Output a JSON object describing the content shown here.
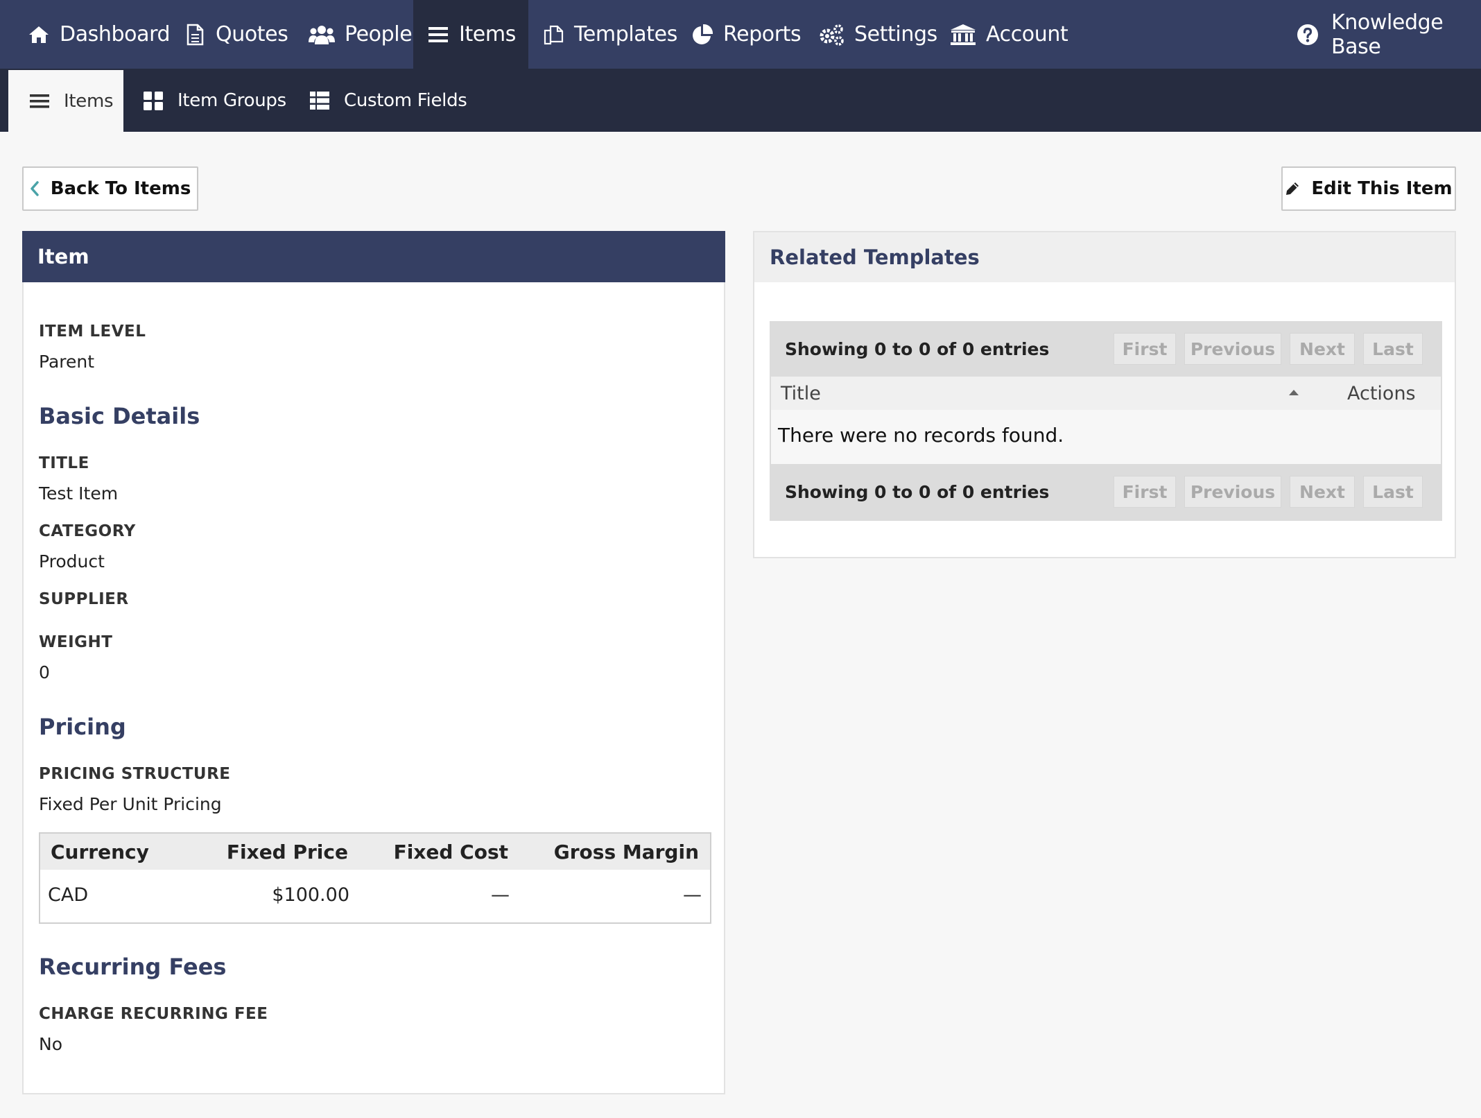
{
  "nav": {
    "items": [
      {
        "label": "Dashboard",
        "icon": "home-icon"
      },
      {
        "label": "Quotes",
        "icon": "document-icon"
      },
      {
        "label": "People",
        "icon": "people-icon"
      },
      {
        "label": "Items",
        "icon": "list-icon",
        "active": true
      },
      {
        "label": "Templates",
        "icon": "templates-icon"
      },
      {
        "label": "Reports",
        "icon": "pie-chart-icon"
      },
      {
        "label": "Settings",
        "icon": "gears-icon"
      },
      {
        "label": "Account",
        "icon": "bank-icon"
      }
    ],
    "help": {
      "label": "Knowledge Base",
      "icon": "question-circle-icon"
    }
  },
  "subnav": {
    "items": [
      {
        "label": "Items",
        "icon": "list-icon",
        "active": true
      },
      {
        "label": "Item Groups",
        "icon": "grid-icon"
      },
      {
        "label": "Custom Fields",
        "icon": "table-list-icon"
      }
    ]
  },
  "actions": {
    "back_label": "Back To Items",
    "edit_label": "Edit This Item"
  },
  "item_panel": {
    "title": "Item",
    "item_level_label": "ITEM LEVEL",
    "item_level_value": "Parent",
    "basic_details_heading": "Basic Details",
    "title_label": "TITLE",
    "title_value": "Test Item",
    "category_label": "CATEGORY",
    "category_value": "Product",
    "supplier_label": "SUPPLIER",
    "supplier_value": "",
    "weight_label": "WEIGHT",
    "weight_value": "0",
    "pricing_heading": "Pricing",
    "pricing_structure_label": "PRICING STRUCTURE",
    "pricing_structure_value": "Fixed Per Unit Pricing",
    "price_table": {
      "headers": [
        "Currency",
        "Fixed Price",
        "Fixed Cost",
        "Gross Margin"
      ],
      "row": [
        "CAD",
        "$100.00",
        "—",
        "—"
      ]
    },
    "recurring_heading": "Recurring Fees",
    "charge_recurring_label": "CHARGE RECURRING FEE",
    "charge_recurring_value": "No"
  },
  "related_templates": {
    "title": "Related Templates",
    "info_top": "Showing 0 to 0 of 0 entries",
    "info_bottom": "Showing 0 to 0 of 0 entries",
    "pager": [
      "First",
      "Previous",
      "Next",
      "Last"
    ],
    "columns": [
      "Title",
      "Actions"
    ],
    "empty_message": "There were no records found."
  },
  "colors": {
    "nav_bg": "#353f63",
    "subnav_bg": "#262c40",
    "accent_heading": "#353f63",
    "back_chevron": "#4aa3a8"
  }
}
